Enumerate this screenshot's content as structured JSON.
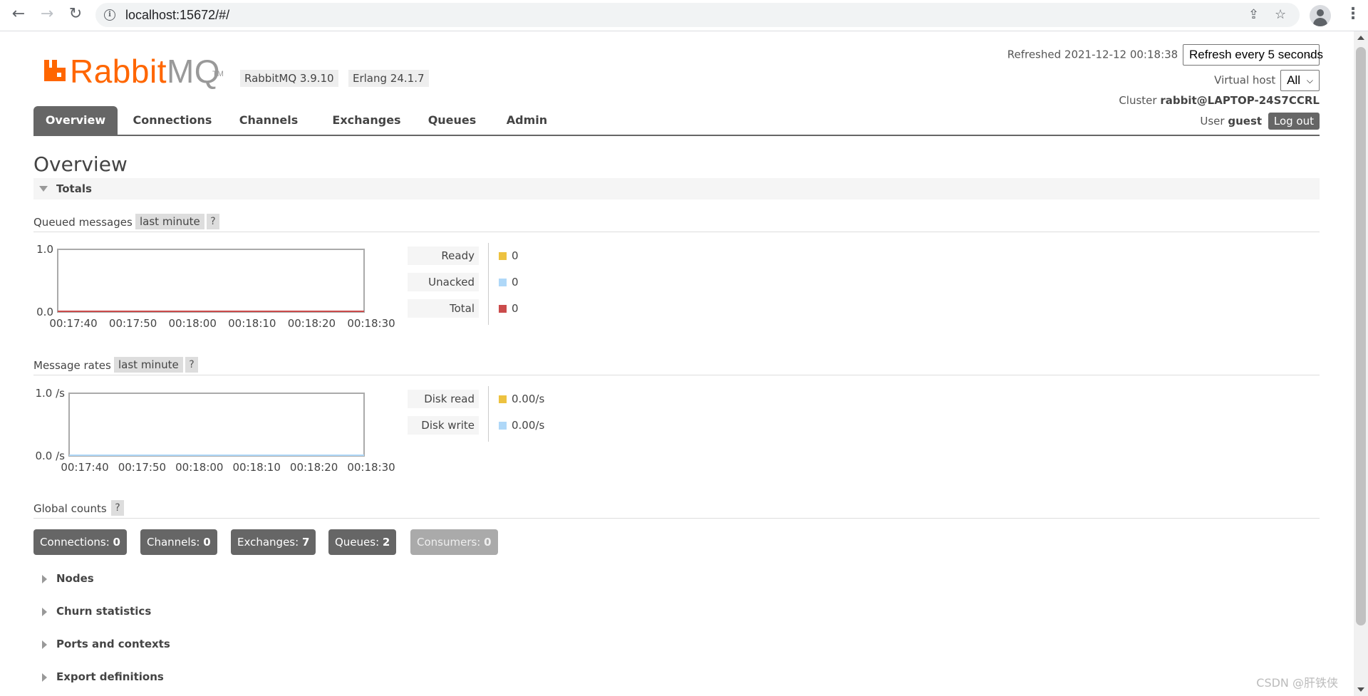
{
  "browser": {
    "url": "localhost:15672/#/"
  },
  "header": {
    "logo_rabbit": "Rabbit",
    "logo_mq": "MQ",
    "logo_tm": "TM",
    "rabbitmq_version": "RabbitMQ 3.9.10",
    "erlang_version": "Erlang 24.1.7",
    "refreshed_label": "Refreshed 2021-12-12 00:18:38",
    "refresh_select": "Refresh every 5 seconds",
    "vhost_label": "Virtual host",
    "vhost_select": "All",
    "cluster_label": "Cluster",
    "cluster_name": "rabbit@LAPTOP-24S7CCRL",
    "user_label": "User",
    "user_name": "guest",
    "logout_label": "Log out"
  },
  "tabs": [
    "Overview",
    "Connections",
    "Channels",
    "Exchanges",
    "Queues",
    "Admin"
  ],
  "page_title": "Overview",
  "totals_section": "Totals",
  "queued_messages": {
    "title": "Queued messages",
    "range": "last minute",
    "help": "?",
    "legend": [
      {
        "label": "Ready",
        "value": "0",
        "color": "#edc240"
      },
      {
        "label": "Unacked",
        "value": "0",
        "color": "#afd8f8"
      },
      {
        "label": "Total",
        "value": "0",
        "color": "#cb4b4b"
      }
    ]
  },
  "message_rates": {
    "title": "Message rates",
    "range": "last minute",
    "help": "?",
    "legend": [
      {
        "label": "Disk read",
        "value": "0.00/s",
        "color": "#edc240"
      },
      {
        "label": "Disk write",
        "value": "0.00/s",
        "color": "#afd8f8"
      }
    ]
  },
  "chart_data": [
    {
      "type": "line",
      "x": [
        "00:17:40",
        "00:17:50",
        "00:18:00",
        "00:18:10",
        "00:18:20",
        "00:18:30"
      ],
      "ylim": [
        0.0,
        1.0
      ],
      "y_tick_labels": [
        "0.0",
        "1.0"
      ],
      "series": [
        {
          "name": "Ready",
          "values": [
            0,
            0,
            0,
            0,
            0,
            0
          ]
        },
        {
          "name": "Unacked",
          "values": [
            0,
            0,
            0,
            0,
            0,
            0
          ]
        },
        {
          "name": "Total",
          "values": [
            0,
            0,
            0,
            0,
            0,
            0
          ]
        }
      ]
    },
    {
      "type": "line",
      "x": [
        "00:17:40",
        "00:17:50",
        "00:18:00",
        "00:18:10",
        "00:18:20",
        "00:18:30"
      ],
      "ylim": [
        0.0,
        1.0
      ],
      "y_tick_labels": [
        "0.0 /s",
        "1.0 /s"
      ],
      "series": [
        {
          "name": "Disk read",
          "values": [
            0,
            0,
            0,
            0,
            0,
            0
          ]
        },
        {
          "name": "Disk write",
          "values": [
            0,
            0,
            0,
            0,
            0,
            0
          ]
        }
      ]
    }
  ],
  "global_counts": {
    "title": "Global counts",
    "help": "?",
    "items": [
      {
        "label": "Connections:",
        "value": "0"
      },
      {
        "label": "Channels:",
        "value": "0"
      },
      {
        "label": "Exchanges:",
        "value": "7"
      },
      {
        "label": "Queues:",
        "value": "2"
      },
      {
        "label": "Consumers:",
        "value": "0"
      }
    ]
  },
  "collapsed_sections": [
    "Nodes",
    "Churn statistics",
    "Ports and contexts",
    "Export definitions"
  ],
  "watermark": "CSDN @肝铁侠"
}
